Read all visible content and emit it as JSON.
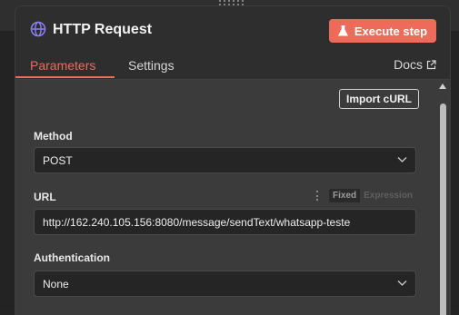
{
  "node": {
    "title": "HTTP Request",
    "icon": "globe-icon",
    "execute_label": "Execute step"
  },
  "tabs": [
    {
      "label": "Parameters",
      "active": true
    },
    {
      "label": "Settings",
      "active": false
    }
  ],
  "docs_label": "Docs",
  "import_label": "Import cURL",
  "method": {
    "label": "Method",
    "value": "POST"
  },
  "url": {
    "label": "URL",
    "value": "http://162.240.105.156:8080/message/sendText/whatsapp-teste",
    "mode_fixed": "Fixed",
    "mode_expression": "Expression"
  },
  "authentication": {
    "label": "Authentication",
    "value": "None"
  },
  "colors": {
    "accent": "#ee6a5a",
    "panel": "#2e2e2e",
    "body": "#3b3b3b",
    "field": "#252525"
  }
}
